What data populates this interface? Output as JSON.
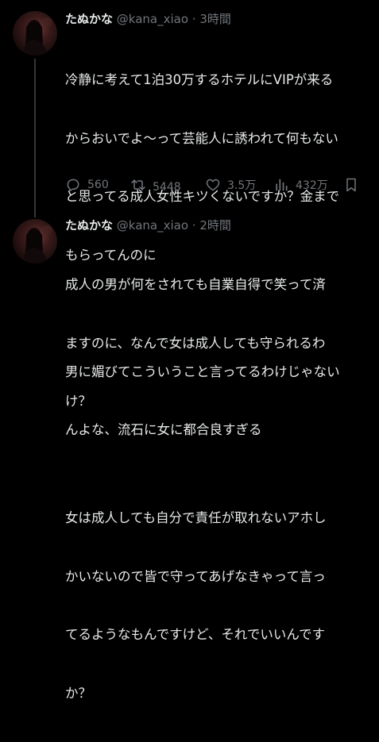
{
  "tweets": [
    {
      "display_name": "たぬかな",
      "handle": "@kana_xiao",
      "separator": "·",
      "time": "3時間",
      "lines": [
        "冷静に考えて1泊30万するホテルにVIPが来る",
        "からおいでよ〜って芸能人に誘われて何もない",
        "と思ってる成人女性キツくないですか？金まで",
        "もらってんのに",
        "",
        "男に媚びてこういうこと言ってるわけじゃない",
        "んよな、流石に女に都合良すぎる"
      ],
      "actions": {
        "reply_icon": "reply-icon",
        "reply_count": "560",
        "retweet_icon": "retweet-icon",
        "retweet_count": "5448",
        "like_icon": "like-icon",
        "like_count": "3.5万",
        "views_icon": "views-icon",
        "views_count": "432万",
        "bookmark_icon": "bookmark-icon"
      }
    },
    {
      "display_name": "たぬかな",
      "handle": "@kana_xiao",
      "separator": "·",
      "time": "2時間",
      "lines": [
        "成人の男が何をされても自業自得で笑って済",
        "ますのに、なんで女は成人しても守られるわ",
        "け？",
        "",
        "女は成人しても自分で責任が取れないアホし",
        "かいないので皆で守ってあげなきゃって言っ",
        "てるようなもんですけど、それでいいんです",
        "か？"
      ]
    }
  ],
  "colors": {
    "background": "#000000",
    "text": "#e7e9ea",
    "secondary": "#71767b",
    "thread_line": "#333639"
  }
}
